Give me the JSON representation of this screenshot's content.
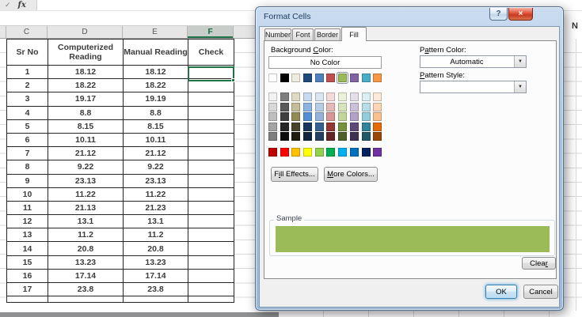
{
  "formula_bar": {
    "confirm_icon": "✓",
    "function_icon": "fx",
    "formula_value": ""
  },
  "sheet": {
    "column_headers": [
      "C",
      "D",
      "E",
      "F"
    ],
    "selected_column": "F",
    "stray_cell_text": "N",
    "table": {
      "headers": [
        "Sr No",
        "Computerized Reading",
        "Manual Reading",
        "Check"
      ],
      "rows": [
        [
          "1",
          "18.12",
          "18.12",
          ""
        ],
        [
          "2",
          "18.22",
          "18.22",
          ""
        ],
        [
          "3",
          "19.17",
          "19.19",
          ""
        ],
        [
          "4",
          "8.8",
          "8.8",
          ""
        ],
        [
          "5",
          "8.15",
          "8.15",
          ""
        ],
        [
          "6",
          "10.11",
          "10.11",
          ""
        ],
        [
          "7",
          "21.12",
          "21.12",
          ""
        ],
        [
          "8",
          "9.22",
          "9.22",
          ""
        ],
        [
          "9",
          "23.13",
          "23.13",
          ""
        ],
        [
          "10",
          "11.22",
          "11.22",
          ""
        ],
        [
          "11",
          "21.13",
          "21.23",
          ""
        ],
        [
          "12",
          "13.1",
          "13.1",
          ""
        ],
        [
          "13",
          "11.2",
          "11.2",
          ""
        ],
        [
          "14",
          "20.8",
          "20.8",
          ""
        ],
        [
          "15",
          "13.23",
          "13.23",
          ""
        ],
        [
          "16",
          "17.14",
          "17.14",
          ""
        ],
        [
          "17",
          "23.8",
          "23.8",
          ""
        ]
      ]
    },
    "selection_color": "#217346",
    "selected_header_color": "#1E7145"
  },
  "dialog": {
    "title": "Format Cells",
    "titlebar": {
      "help_icon": "?",
      "close_icon": "×"
    },
    "tabs": [
      "Number",
      "Font",
      "Border",
      "Fill"
    ],
    "active_tab": "Fill",
    "labels": {
      "background_color": {
        "pre": "Background ",
        "key": "C",
        "post": "olor:"
      },
      "pattern_color": {
        "pre": "P",
        "key": "a",
        "post": "ttern Color:"
      },
      "pattern_style": {
        "pre": "",
        "key": "P",
        "post": "attern Style:"
      },
      "fill_effects": {
        "pre": "F",
        "key": "i",
        "post": "ll Effects..."
      },
      "more_colors": {
        "pre": "",
        "key": "M",
        "post": "ore Colors..."
      },
      "clear": {
        "pre": "Clea",
        "key": "r",
        "post": ""
      },
      "no_color": "No Color",
      "sample": "Sample",
      "ok": "OK",
      "cancel": "Cancel"
    },
    "pattern_color_value": "Automatic",
    "pattern_style_value": "",
    "dropdown_arrow_icon": "▼",
    "sample_fill_color": "#9BBB59",
    "palette": {
      "selected": {
        "row": "theme",
        "index": 6,
        "color": "#9BBB59"
      },
      "theme_colors": [
        "#FFFFFF",
        "#000000",
        "#EEECE1",
        "#1F497D",
        "#4F81BD",
        "#C0504D",
        "#9BBB59",
        "#8064A2",
        "#4BACC6",
        "#F79646"
      ],
      "tint_rows": [
        [
          "#F2F2F2",
          "#7F7F7F",
          "#DDD9C3",
          "#C6D9F0",
          "#DBE5F1",
          "#F2DCDB",
          "#EBF1DD",
          "#E5DFEC",
          "#DBEEF3",
          "#FDEADA"
        ],
        [
          "#D8D8D8",
          "#595959",
          "#C4BD97",
          "#8DB3E2",
          "#B8CCE4",
          "#E5B9B7",
          "#D7E3BC",
          "#CCC1D9",
          "#B7DDE8",
          "#FBD5B5"
        ],
        [
          "#BFBFBF",
          "#3F3F3F",
          "#938953",
          "#548DD4",
          "#95B3D7",
          "#D99694",
          "#C3D69B",
          "#B2A2C7",
          "#92CDDC",
          "#FAC08F"
        ],
        [
          "#A5A5A5",
          "#262626",
          "#494429",
          "#17365D",
          "#366092",
          "#953734",
          "#76923C",
          "#5F497A",
          "#31859B",
          "#E36C09"
        ],
        [
          "#7F7F7F",
          "#0C0C0C",
          "#1D1B10",
          "#0F243E",
          "#244061",
          "#632423",
          "#4F6128",
          "#3F3151",
          "#215967",
          "#974806"
        ]
      ],
      "standard_colors": [
        "#C00000",
        "#FF0000",
        "#FFC000",
        "#FFFF00",
        "#92D050",
        "#00B050",
        "#00B0F0",
        "#0070C0",
        "#002060",
        "#7030A0"
      ]
    }
  }
}
